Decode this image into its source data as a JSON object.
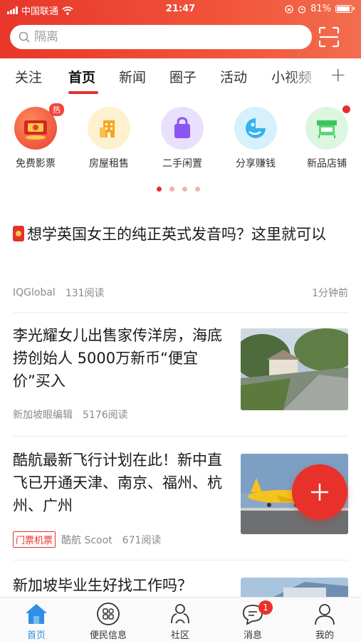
{
  "status_bar": {
    "carrier": "中国联通",
    "time": "21:47",
    "battery": "81%",
    "battery_level": 0.81
  },
  "search": {
    "placeholder": "隔离"
  },
  "tabs": [
    {
      "label": "关注",
      "active": false
    },
    {
      "label": "首页",
      "active": true
    },
    {
      "label": "新闻",
      "active": false
    },
    {
      "label": "圈子",
      "active": false
    },
    {
      "label": "活动",
      "active": false
    },
    {
      "label": "小视频",
      "active": false
    }
  ],
  "services": [
    {
      "label": "免费影票",
      "icon": "ticket-icon",
      "badge": "热",
      "color": "#f6553f"
    },
    {
      "label": "房屋租售",
      "icon": "building-icon",
      "color": "#f6a623"
    },
    {
      "label": "二手闲置",
      "icon": "shopping-bag-icon",
      "color": "#8a55f2"
    },
    {
      "label": "分享赚钱",
      "icon": "share-earn-icon",
      "color": "#35b3f0"
    },
    {
      "label": "新品店铺",
      "icon": "shop-stall-icon",
      "color": "#3cc55a",
      "dot": true
    }
  ],
  "carousel": {
    "pages": 4,
    "current": 1
  },
  "articles": [
    {
      "title": "想学英国女王的纯正英式发音吗？这里就可以",
      "source": "IQGlobal",
      "reads": "131阅读",
      "time": "1分钟前"
    },
    {
      "title": "李光耀女儿出售家传洋房，海底捞创始人 5000万新币“便宜价”买入",
      "source": "新加坡眼编辑",
      "reads": "5176阅读"
    },
    {
      "title": "酷航最新飞行计划在此！新中直飞已开通天津、南京、福州、杭州、广州",
      "tag": "门票机票",
      "source": "酷航 Scoot",
      "reads": "671阅读"
    },
    {
      "title": "新加坡毕业生好找工作吗？"
    }
  ],
  "bottom_nav": [
    {
      "label": "首页",
      "icon": "home-icon",
      "active": true
    },
    {
      "label": "便民信息",
      "icon": "grid-services-icon"
    },
    {
      "label": "社区",
      "icon": "community-icon"
    },
    {
      "label": "消息",
      "icon": "message-icon",
      "badge": "1"
    },
    {
      "label": "我的",
      "icon": "profile-icon"
    }
  ],
  "colors": {
    "brand_red": "#e4322a",
    "active_blue": "#2f8fe6"
  }
}
